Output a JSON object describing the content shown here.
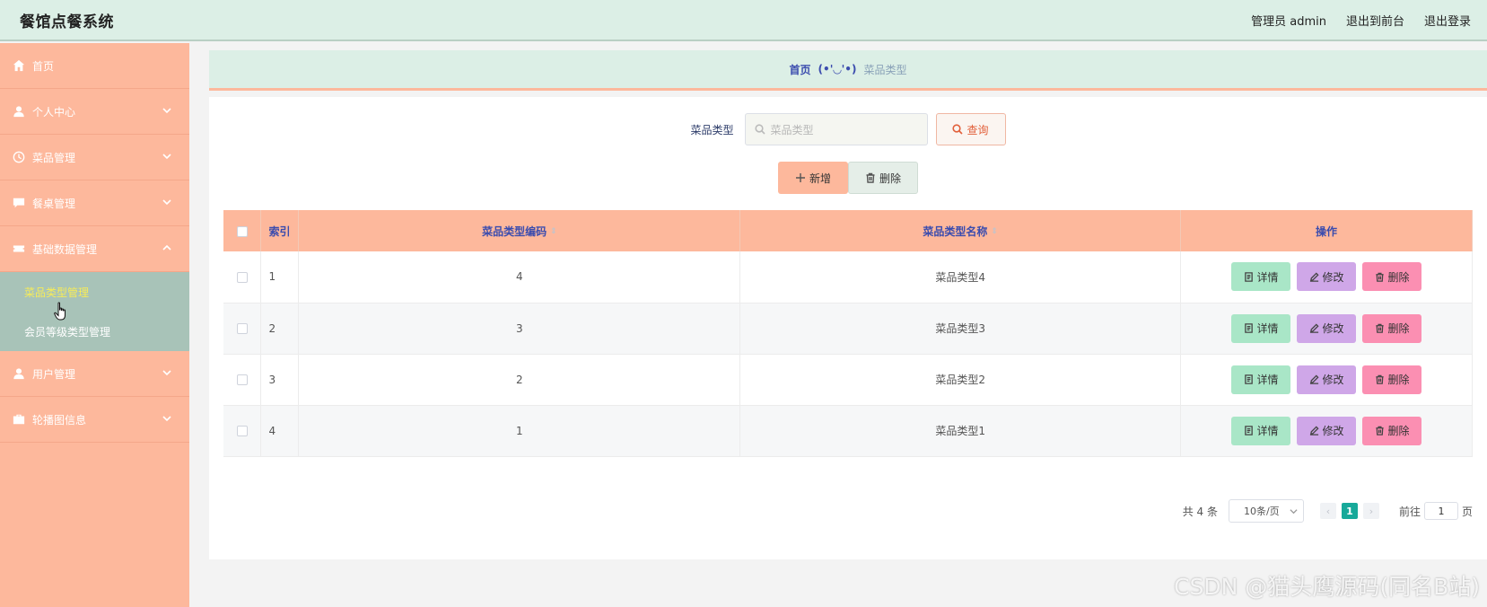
{
  "header": {
    "title": "餐馆点餐系统",
    "admin_label": "管理员 admin",
    "front_label": "退出到前台",
    "logout_label": "退出登录"
  },
  "sidebar": {
    "items": [
      {
        "label": "首页",
        "icon": "home-icon"
      },
      {
        "label": "个人中心",
        "icon": "user-icon"
      },
      {
        "label": "菜品管理",
        "icon": "clock-icon"
      },
      {
        "label": "餐桌管理",
        "icon": "chat-icon"
      },
      {
        "label": "基础数据管理",
        "icon": "ticket-icon"
      },
      {
        "label": "用户管理",
        "icon": "user-icon"
      },
      {
        "label": "轮播图信息",
        "icon": "briefcase-icon"
      }
    ],
    "submenu": [
      {
        "label": "菜品类型管理",
        "active": true
      },
      {
        "label": "会员等级类型管理",
        "active": false
      }
    ]
  },
  "breadcrumb": {
    "home": "首页",
    "separator": "(•'◡'•)",
    "current": "菜品类型"
  },
  "search": {
    "label": "菜品类型",
    "placeholder": "菜品类型",
    "button": "查询"
  },
  "actions": {
    "add": "新增",
    "delete": "删除"
  },
  "table": {
    "columns": [
      "索引",
      "菜品类型编码",
      "菜品类型名称",
      "操作"
    ],
    "rows": [
      {
        "index": "1",
        "code": "4",
        "name": "菜品类型4"
      },
      {
        "index": "2",
        "code": "3",
        "name": "菜品类型3"
      },
      {
        "index": "3",
        "code": "2",
        "name": "菜品类型2"
      },
      {
        "index": "4",
        "code": "1",
        "name": "菜品类型1"
      }
    ],
    "ops": {
      "detail": "详情",
      "edit": "修改",
      "remove": "删除"
    }
  },
  "pagination": {
    "total": "共 4 条",
    "page_size": "10条/页",
    "current_page": "1",
    "goto_label": "前往",
    "goto_value": "1",
    "page_suffix": "页"
  },
  "watermark": "CSDN @猫头鹰源码(同名B站)",
  "colors": {
    "header_bg": "#dcefe6",
    "sidebar_bg": "#fdb89c",
    "submenu_bg": "#a8c3b8",
    "accent_blue": "#3b4cae",
    "detail_btn": "#a9e6c7",
    "edit_btn": "#cfa7e8",
    "remove_btn": "#fb8fb2",
    "page_active": "#17a99a"
  }
}
